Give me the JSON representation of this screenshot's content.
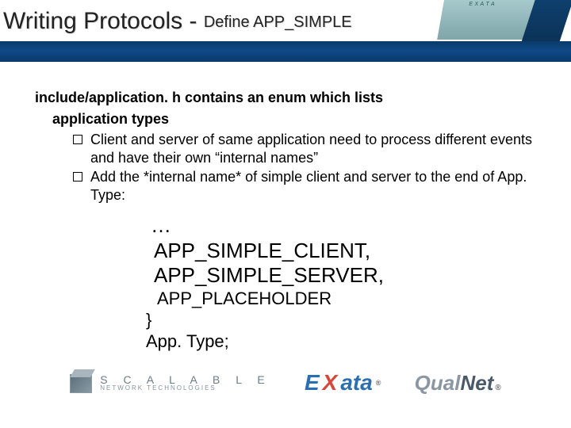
{
  "title": {
    "main": "Writing Protocols - ",
    "sub": "Define APP_SIMPLE"
  },
  "heading": "include/application. h contains an enum which lists",
  "heading2": "application types",
  "bullets": [
    "Client and server of same application need to process different events and have their own “internal names”",
    "Add the *internal name* of simple client and server  to the end of App. Type:"
  ],
  "enum": {
    "dots": "…",
    "line1": "APP_SIMPLE_CLIENT,",
    "line2": "APP_SIMPLE_SERVER,",
    "line3": " APP_PLACEHOLDER",
    "line4": "}",
    "line5": "App. Type;"
  },
  "corner": {
    "tag": "E X A T A",
    "brand": "QualNet®"
  },
  "logos": {
    "scalable_l1": "S C A L A B L E",
    "scalable_l2": "NETWORK TECHNOLOGIES",
    "exata_e": "E",
    "exata_x": "X",
    "exata_ata": "ata",
    "qualnet_q": "Qual",
    "qualnet_n": "Net",
    "reg": "®"
  }
}
